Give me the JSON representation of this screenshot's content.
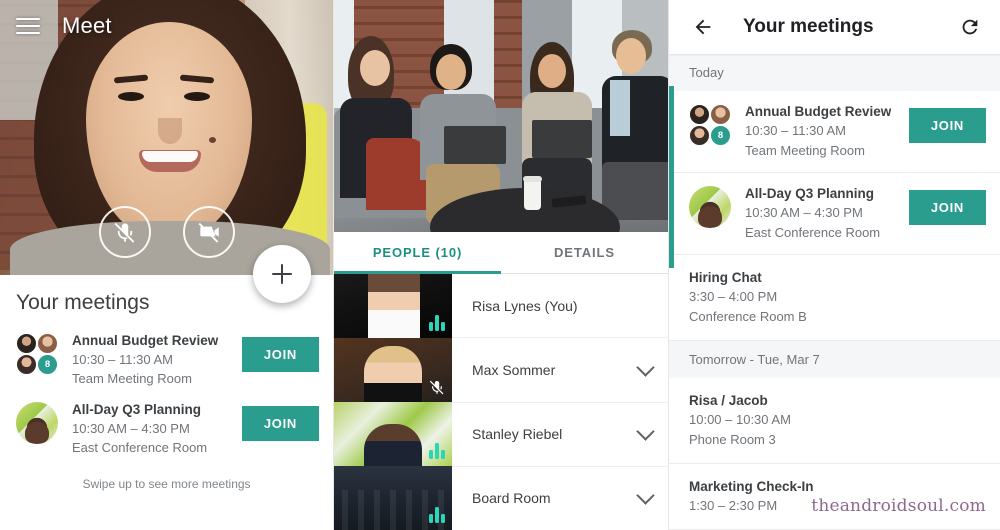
{
  "left_panel": {
    "app_title": "Meet",
    "menu_icon": "hamburger-icon",
    "controls": [
      {
        "icon": "mic-off-icon",
        "label": "Microphone off"
      },
      {
        "icon": "video-off-icon",
        "label": "Camera off"
      }
    ],
    "fab": {
      "icon": "plus-icon",
      "label": "New meeting"
    },
    "sheet": {
      "title": "Your meetings",
      "meetings": [
        {
          "name": "Annual Budget Review",
          "time": "10:30 – 11:30 AM",
          "room": "Team Meeting Room",
          "join_label": "JOIN",
          "avatar_type": "cluster",
          "overflow_count": "8"
        },
        {
          "name": "All-Day Q3 Planning",
          "time": "10:30 AM – 4:30 PM",
          "room": "East Conference Room",
          "join_label": "JOIN",
          "avatar_type": "single",
          "overflow_count": ""
        }
      ],
      "swipe_hint": "Swipe up to see more meetings"
    }
  },
  "middle_panel": {
    "tabs": [
      {
        "label": "PEOPLE (10)",
        "active": true
      },
      {
        "label": "DETAILS",
        "active": false
      }
    ],
    "participants": [
      {
        "name": "Risa Lynes (You)",
        "has_chevron": false,
        "indicator": "audio-level"
      },
      {
        "name": "Max Sommer",
        "has_chevron": true,
        "indicator": "mic-off"
      },
      {
        "name": "Stanley Riebel",
        "has_chevron": true,
        "indicator": "audio-level"
      },
      {
        "name": "Board Room",
        "has_chevron": true,
        "indicator": "audio-level"
      }
    ]
  },
  "right_panel": {
    "header": {
      "back_icon": "back-arrow-icon",
      "title": "Your meetings",
      "refresh_icon": "refresh-icon"
    },
    "sections": [
      {
        "heading": "Today",
        "items": [
          {
            "name": "Annual Budget Review",
            "time": "10:30 – 11:30 AM",
            "room": "Team Meeting Room",
            "join_label": "JOIN",
            "avatar_type": "cluster",
            "overflow_count": "8",
            "accent": true
          },
          {
            "name": "All-Day Q3 Planning",
            "time": "10:30 AM – 4:30 PM",
            "room": "East Conference Room",
            "join_label": "JOIN",
            "avatar_type": "single",
            "overflow_count": "",
            "accent": true
          },
          {
            "name": "Hiring Chat",
            "time": "3:30 – 4:00 PM",
            "room": "Conference Room B",
            "join_label": "",
            "avatar_type": "none",
            "overflow_count": "",
            "accent": false
          }
        ]
      },
      {
        "heading": "Tomorrow - Tue, Mar 7",
        "items": [
          {
            "name": "Risa / Jacob",
            "time": "10:00 – 10:30 AM",
            "room": "Phone Room 3",
            "join_label": "",
            "avatar_type": "none",
            "overflow_count": "",
            "accent": false
          },
          {
            "name": "Marketing Check-In",
            "time": "1:30 – 2:30 PM",
            "room": "",
            "join_label": "",
            "avatar_type": "none",
            "overflow_count": "",
            "accent": false
          }
        ]
      }
    ]
  },
  "watermark": "theandroidsoul.com",
  "colors": {
    "accent_teal": "#2a9d8f",
    "tab_active": "#1d8f81",
    "text_primary": "#3c4043",
    "text_secondary": "#70757a",
    "watermark": "#8d6a8d"
  }
}
